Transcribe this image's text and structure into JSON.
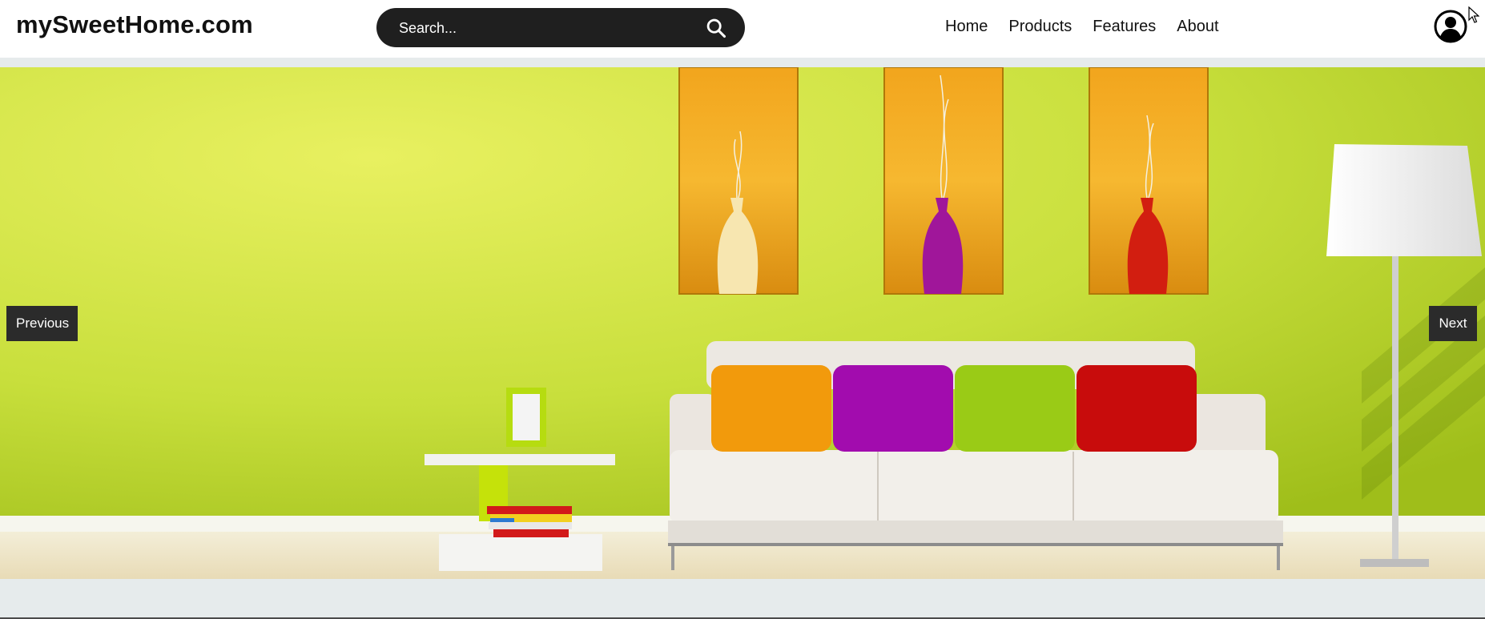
{
  "header": {
    "brand": "mySweetHome.com",
    "search": {
      "placeholder": "Search...",
      "value": "",
      "button_icon": "search-icon"
    },
    "nav": [
      "Home",
      "Products",
      "Features",
      "About"
    ],
    "account_icon": "user-circle-icon"
  },
  "hero": {
    "image_alt": "Living room with lime green wall, niches with vases, white sofa with colorful pillows, side table with frame and books, floor lamp",
    "previous_label": "Previous",
    "next_label": "Next"
  },
  "colors": {
    "header_bg": "#ffffff",
    "page_bg": "#e6ebec",
    "search_bg": "#1f1f1f",
    "button_bg": "#2b2b2b",
    "wall": "#c8e040",
    "niche": "#f0a21a"
  }
}
